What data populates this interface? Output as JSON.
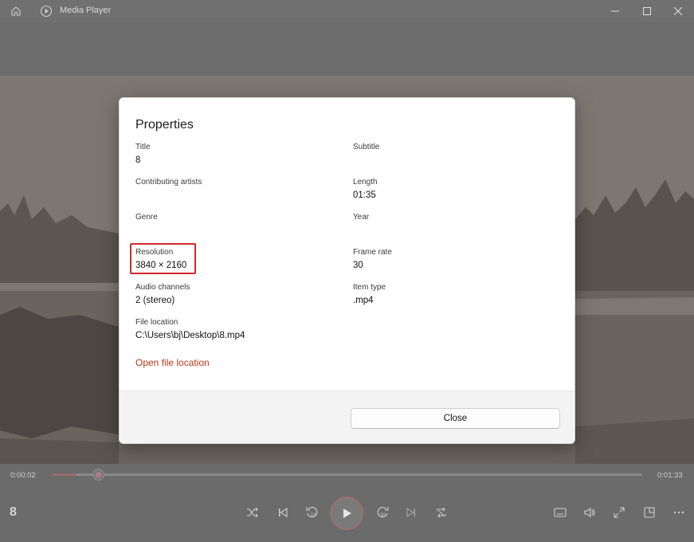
{
  "titlebar": {
    "app_title": "Media Player",
    "icons": {
      "home": "home-icon",
      "app": "play-circle-icon",
      "minimize": "minimize-icon",
      "maximize": "maximize-icon",
      "close": "close-icon"
    }
  },
  "dialog": {
    "title": "Properties",
    "fields": {
      "title": {
        "label": "Title",
        "value": "8"
      },
      "subtitle": {
        "label": "Subtitle",
        "value": ""
      },
      "contributing_artists": {
        "label": "Contributing artists",
        "value": ""
      },
      "length": {
        "label": "Length",
        "value": "01:35"
      },
      "genre": {
        "label": "Genre",
        "value": ""
      },
      "year": {
        "label": "Year",
        "value": ""
      },
      "resolution": {
        "label": "Resolution",
        "value": "3840 × 2160"
      },
      "frame_rate": {
        "label": "Frame rate",
        "value": "30"
      },
      "audio_channels": {
        "label": "Audio channels",
        "value": "2 (stereo)"
      },
      "item_type": {
        "label": "Item type",
        "value": ".mp4"
      },
      "file_location": {
        "label": "File location",
        "value": "C:\\Users\\bj\\Desktop\\8.mp4"
      }
    },
    "open_file_location_label": "Open file location",
    "close_label": "Close",
    "highlight_color": "#d2282e",
    "link_color": "#b83a1a"
  },
  "player": {
    "current_time": "0:00:02",
    "total_time": "0:01:33",
    "progress": 0.04,
    "now_playing_title": "8",
    "skip_back_seconds": "10",
    "skip_forward_seconds": "30",
    "accent_color": "#b47a7f"
  }
}
